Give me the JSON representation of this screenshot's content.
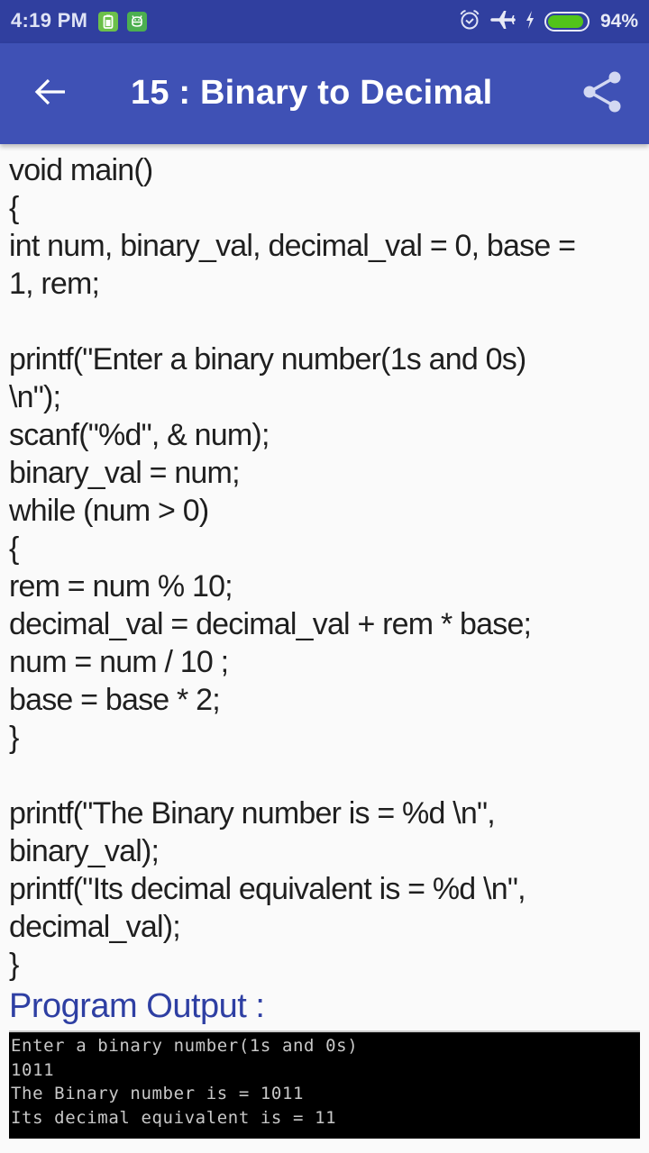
{
  "status_bar": {
    "time": "4:19 PM",
    "notification_icons": [
      "battery-saver-icon",
      "android-icon"
    ],
    "system_icons": [
      "alarm-icon",
      "airplane-mode-icon",
      "charging-bolt-icon",
      "battery-icon"
    ],
    "battery_percent_label": "94%",
    "battery_level": 0.94,
    "colors": {
      "background": "#303f9f",
      "battery_fill": "#52c41a"
    }
  },
  "app_bar": {
    "back_icon": "arrow-left-icon",
    "title": "15 : Binary to Decimal",
    "share_icon": "share-icon",
    "colors": {
      "background": "#3f51b5",
      "text": "#ffffff"
    }
  },
  "code": {
    "lines": [
      "void main()",
      "{",
      "int num, binary_val, decimal_val = 0, base =",
      "1, rem;",
      "",
      "printf(\"Enter a binary number(1s and 0s)",
      "\\n\");",
      "scanf(\"%d\", & num);",
      "binary_val = num;",
      "while (num > 0)",
      "{",
      "rem = num % 10;",
      "decimal_val = decimal_val + rem * base;",
      "num = num / 10 ;",
      "base = base * 2;",
      "}",
      "",
      "printf(\"The Binary number is = %d \\n\",",
      "binary_val);",
      "printf(\"Its decimal equivalent is = %d \\n\",",
      "decimal_val);",
      "}"
    ]
  },
  "output": {
    "heading": "Program Output :",
    "heading_color": "#2e3fa3",
    "console_lines": [
      "Enter a binary number(1s and 0s)",
      "1011",
      "The Binary number is = 1011",
      "Its decimal equivalent is = 11"
    ]
  }
}
